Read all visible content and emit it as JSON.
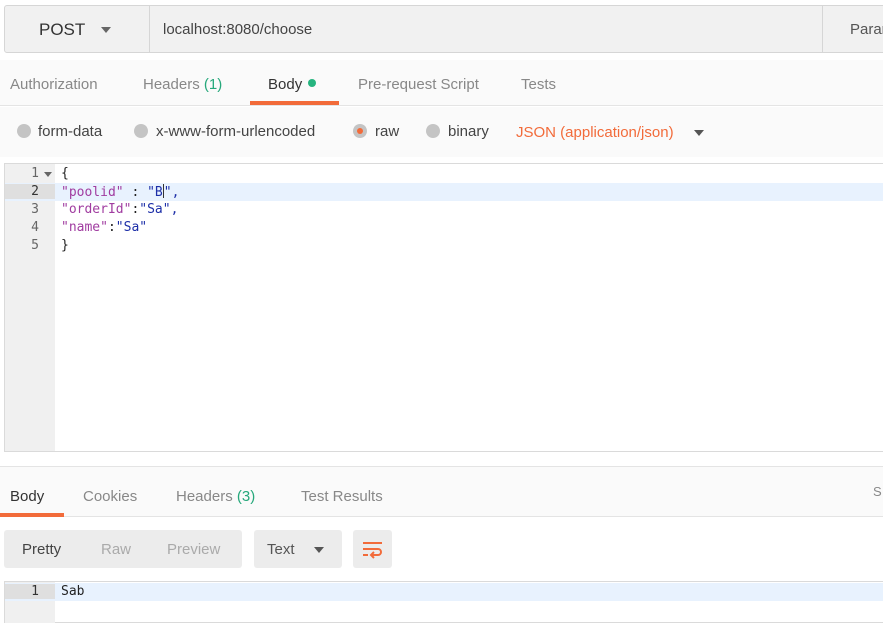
{
  "request": {
    "method": "POST",
    "url": "localhost:8080/choose",
    "params_label": "Params"
  },
  "request_tabs": {
    "authorization": "Authorization",
    "headers": "Headers",
    "headers_count": "(1)",
    "body": "Body",
    "prerequest": "Pre-request Script",
    "tests": "Tests"
  },
  "body_types": {
    "form_data": "form-data",
    "urlencoded": "x-www-form-urlencoded",
    "raw": "raw",
    "binary": "binary",
    "selected": "raw",
    "content_type": "JSON (application/json)"
  },
  "editor": {
    "lines": [
      {
        "no": "1",
        "text": "{"
      },
      {
        "no": "2",
        "key": "\"poolid\"",
        "sep": " : ",
        "value_before_cursor": "\"B",
        "value_after_cursor": "\",",
        "highlighted": true
      },
      {
        "no": "3",
        "key": "\"orderId\"",
        "sep": ":",
        "value": "\"Sa\","
      },
      {
        "no": "4",
        "key": "\"name\"",
        "sep": ":",
        "value": "\"Sa\""
      },
      {
        "no": "5",
        "text": "}"
      }
    ]
  },
  "response_tabs": {
    "body": "Body",
    "cookies": "Cookies",
    "headers": "Headers",
    "headers_count": "(3)",
    "test_results": "Test Results",
    "status_partial": "S"
  },
  "response_toolbar": {
    "pretty": "Pretty",
    "raw": "Raw",
    "preview": "Preview",
    "format": "Text",
    "wrap_icon": "wrap-lines-icon"
  },
  "response_body": {
    "lines": [
      {
        "no": "1",
        "text": "Sab"
      }
    ]
  },
  "colors": {
    "accent": "#f26b3a",
    "count": "#26a87b",
    "active_dot": "#26b47f",
    "line_highlight": "#e8f2fe"
  }
}
